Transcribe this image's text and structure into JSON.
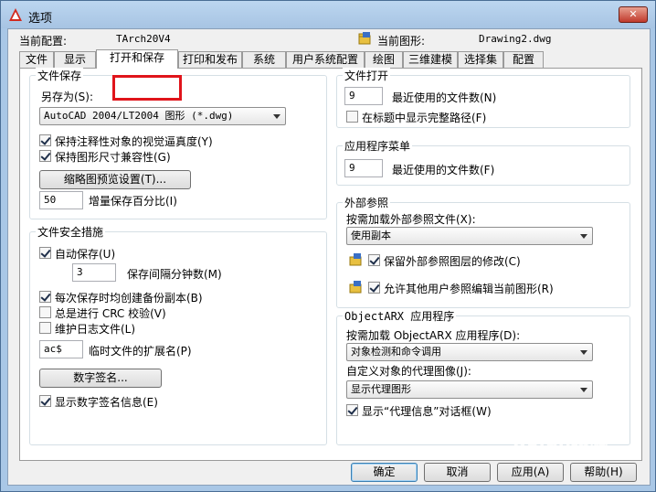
{
  "window": {
    "title": "选项",
    "close_symbol": "✕"
  },
  "header": {
    "current_profile_label": "当前配置:",
    "current_profile_value": "TArch20V4",
    "current_drawing_label": "当前图形:",
    "current_drawing_value": "Drawing2.dwg"
  },
  "tabs": [
    {
      "label": "文件"
    },
    {
      "label": "显示"
    },
    {
      "label": "打开和保存",
      "active": true
    },
    {
      "label": "打印和发布"
    },
    {
      "label": "系统"
    },
    {
      "label": "用户系统配置"
    },
    {
      "label": "绘图"
    },
    {
      "label": "三维建模"
    },
    {
      "label": "选择集"
    },
    {
      "label": "配置"
    }
  ],
  "file_save": {
    "title": "文件保存",
    "save_as_label": "另存为(S):",
    "save_as_value": "AutoCAD 2004/LT2004 图形 (*.dwg)",
    "keep_annotative_label": "保持注释性对象的视觉逼真度(Y)",
    "keep_annotative_checked": true,
    "keep_drawing_size_label": "保持图形尺寸兼容性(G)",
    "keep_drawing_size_checked": true,
    "thumbnail_button": "缩略图预览设置(T)...",
    "incremental_value": "50",
    "incremental_label": "增量保存百分比(I)"
  },
  "file_safety": {
    "title": "文件安全措施",
    "autosave_label": "自动保存(U)",
    "autosave_checked": true,
    "interval_value": "3",
    "interval_label": "保存间隔分钟数(M)",
    "backup_label": "每次保存时均创建备份副本(B)",
    "backup_checked": true,
    "crc_label": "总是进行 CRC 校验(V)",
    "crc_checked": false,
    "log_label": "维护日志文件(L)",
    "log_checked": false,
    "temp_ext_value": "ac$",
    "temp_ext_label": "临时文件的扩展名(P)",
    "digital_sig_button": "数字签名...",
    "show_sig_label": "显示数字签名信息(E)",
    "show_sig_checked": true
  },
  "file_open": {
    "title": "文件打开",
    "recent_value": "9",
    "recent_label": "最近使用的文件数(N)",
    "full_path_label": "在标题中显示完整路径(F)",
    "full_path_checked": false
  },
  "app_menu": {
    "title": "应用程序菜单",
    "recent_value": "9",
    "recent_label": "最近使用的文件数(F)"
  },
  "xref": {
    "title": "外部参照",
    "demand_load_label": "按需加载外部参照文件(X):",
    "demand_load_value": "使用副本",
    "retain_changes_label": "保留外部参照图层的修改(C)",
    "retain_changes_checked": true,
    "allow_edit_label": "允许其他用户参照编辑当前图形(R)",
    "allow_edit_checked": true
  },
  "objectarx": {
    "title": "ObjectARX 应用程序",
    "demand_load_label": "按需加载 ObjectARX 应用程序(D):",
    "demand_load_value": "对象检测和命令调用",
    "proxy_images_label": "自定义对象的代理图像(J):",
    "proxy_images_value": "显示代理图形",
    "show_proxy_label": "显示“代理信息”对话框(W)",
    "show_proxy_checked": true
  },
  "buttons": {
    "ok": "确定",
    "cancel": "取消",
    "apply": "应用(A)",
    "help": "帮助(H)"
  },
  "watermark": "Baidu经验",
  "colors": {
    "titlebar": "#bcd6f0",
    "highlight": "#e0141b",
    "close_button": "#c0392b"
  }
}
